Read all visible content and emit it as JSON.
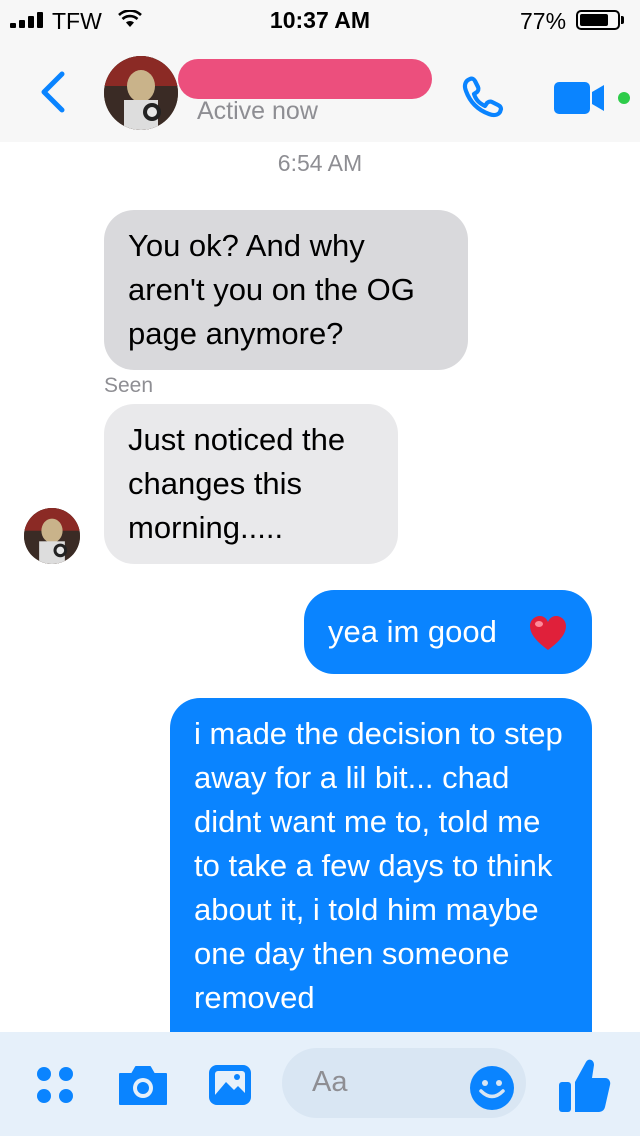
{
  "status_bar": {
    "carrier": "TFW",
    "time": "10:37 AM",
    "battery": "77%",
    "battery_level": 0.77
  },
  "header": {
    "status": "Active now",
    "icons": [
      "back-chevron-icon",
      "phone-icon",
      "video-camera-icon",
      "online-dot-icon"
    ],
    "accent_color": "#0a84ff"
  },
  "chat": {
    "timestamp": "6:54 AM",
    "seen_label": "Seen",
    "messages": [
      {
        "from": "them",
        "text": "You ok?  And why aren't you on the OG page anymore?"
      },
      {
        "from": "them",
        "text": "Just noticed the changes this morning....."
      },
      {
        "from": "me",
        "text": "yea im good",
        "emoji": "heart"
      },
      {
        "from": "me",
        "text": "i made the decision to step away for a lil bit... chad didnt want me to, told me to take a few days to think about it, i told him maybe one day then someone removed"
      }
    ]
  },
  "composer": {
    "placeholder": "Aa",
    "icons": [
      "menu-dots-icon",
      "camera-icon",
      "photo-icon",
      "emoji-icon",
      "thumbs-up-icon"
    ]
  }
}
